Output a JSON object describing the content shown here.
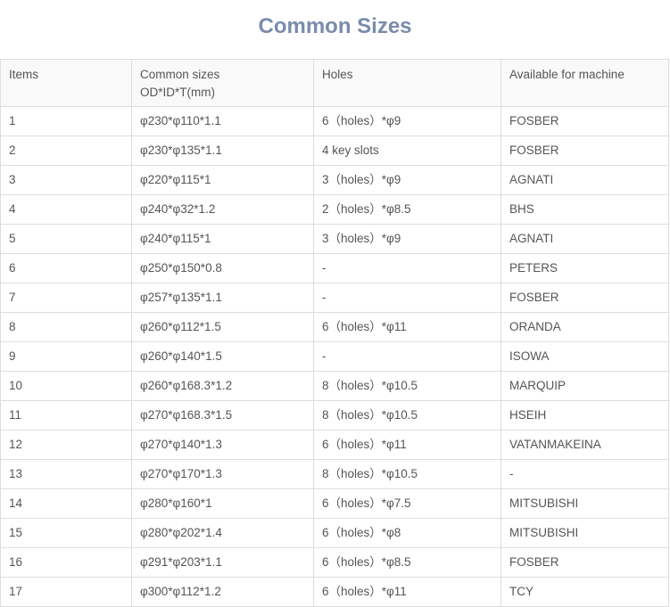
{
  "page": {
    "title": "Common Sizes"
  },
  "table": {
    "headers": {
      "items": "Items",
      "sizes_line1": "Common sizes",
      "sizes_line2": "OD*ID*T(mm)",
      "holes": "Holes",
      "machine": "Available for machine"
    },
    "rows": [
      {
        "item": "1",
        "size": "φ230*φ110*1.1",
        "holes": "6（holes）*φ9",
        "machine": "FOSBER"
      },
      {
        "item": "2",
        "size": "φ230*φ135*1.1",
        "holes": "4 key slots",
        "machine": "FOSBER"
      },
      {
        "item": "3",
        "size": "φ220*φ115*1",
        "holes": "3（holes）*φ9",
        "machine": "AGNATI"
      },
      {
        "item": "4",
        "size": "φ240*φ32*1.2",
        "holes": "2（holes）*φ8.5",
        "machine": "BHS"
      },
      {
        "item": "5",
        "size": "φ240*φ115*1",
        "holes": "3（holes）*φ9",
        "machine": "AGNATI"
      },
      {
        "item": "6",
        "size": "φ250*φ150*0.8",
        "holes": "-",
        "machine": "PETERS"
      },
      {
        "item": "7",
        "size": "φ257*φ135*1.1",
        "holes": "-",
        "machine": "FOSBER"
      },
      {
        "item": "8",
        "size": "φ260*φ112*1.5",
        "holes": "6（holes）*φ11",
        "machine": "ORANDA"
      },
      {
        "item": "9",
        "size": "φ260*φ140*1.5",
        "holes": "-",
        "machine": "ISOWA"
      },
      {
        "item": "10",
        "size": "φ260*φ168.3*1.2",
        "holes": "8（holes）*φ10.5",
        "machine": "MARQUIP"
      },
      {
        "item": "11",
        "size": "φ270*φ168.3*1.5",
        "holes": "8（holes）*φ10.5",
        "machine": "HSEIH"
      },
      {
        "item": "12",
        "size": "φ270*φ140*1.3",
        "holes": "6（holes）*φ11",
        "machine": "VATANMAKEINA"
      },
      {
        "item": "13",
        "size": "φ270*φ170*1.3",
        "holes": "8（holes）*φ10.5",
        "machine": "-"
      },
      {
        "item": "14",
        "size": "φ280*φ160*1",
        "holes": "6（holes）*φ7.5",
        "machine": "MITSUBISHI"
      },
      {
        "item": "15",
        "size": "φ280*φ202*1.4",
        "holes": "6（holes）*φ8",
        "machine": "MITSUBISHI"
      },
      {
        "item": "16",
        "size": "φ291*φ203*1.1",
        "holes": "6（holes）*φ8.5",
        "machine": "FOSBER"
      },
      {
        "item": "17",
        "size": "φ300*φ112*1.2",
        "holes": "6（holes）*φ11",
        "machine": "TCY"
      }
    ]
  }
}
